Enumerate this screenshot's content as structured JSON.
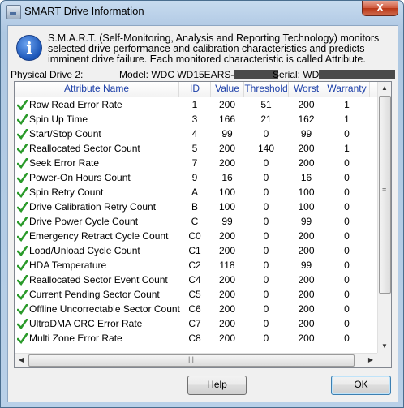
{
  "window": {
    "title": "SMART Drive Information",
    "close_label": "X"
  },
  "description": "S.M.A.R.T. (Self-Monitoring, Analysis and Reporting Technology) monitors selected drive performance and calibration characteristics and predicts imminent drive failure. Each monitored characteristic is called Attribute.",
  "drive": {
    "physical_label": "Physical Drive 2:",
    "model_label": "Model: WDC WD15EARS-",
    "serial_label": "Serial: WD"
  },
  "table": {
    "columns": [
      "Attribute Name",
      "ID",
      "Value",
      "Threshold",
      "Worst",
      "Warranty"
    ],
    "rows": [
      {
        "name": "Raw Read Error Rate",
        "id": "1",
        "value": "200",
        "threshold": "51",
        "worst": "200",
        "warranty": "1"
      },
      {
        "name": "Spin Up Time",
        "id": "3",
        "value": "166",
        "threshold": "21",
        "worst": "162",
        "warranty": "1"
      },
      {
        "name": "Start/Stop Count",
        "id": "4",
        "value": "99",
        "threshold": "0",
        "worst": "99",
        "warranty": "0"
      },
      {
        "name": "Reallocated Sector Count",
        "id": "5",
        "value": "200",
        "threshold": "140",
        "worst": "200",
        "warranty": "1"
      },
      {
        "name": "Seek Error Rate",
        "id": "7",
        "value": "200",
        "threshold": "0",
        "worst": "200",
        "warranty": "0"
      },
      {
        "name": "Power-On Hours Count",
        "id": "9",
        "value": "16",
        "threshold": "0",
        "worst": "16",
        "warranty": "0"
      },
      {
        "name": "Spin Retry Count",
        "id": "A",
        "value": "100",
        "threshold": "0",
        "worst": "100",
        "warranty": "0"
      },
      {
        "name": "Drive Calibration Retry Count",
        "id": "B",
        "value": "100",
        "threshold": "0",
        "worst": "100",
        "warranty": "0"
      },
      {
        "name": "Drive Power Cycle Count",
        "id": "C",
        "value": "99",
        "threshold": "0",
        "worst": "99",
        "warranty": "0"
      },
      {
        "name": "Emergency Retract Cycle Count",
        "id": "C0",
        "value": "200",
        "threshold": "0",
        "worst": "200",
        "warranty": "0"
      },
      {
        "name": "Load/Unload Cycle Count",
        "id": "C1",
        "value": "200",
        "threshold": "0",
        "worst": "200",
        "warranty": "0"
      },
      {
        "name": "HDA Temperature",
        "id": "C2",
        "value": "118",
        "threshold": "0",
        "worst": "99",
        "warranty": "0"
      },
      {
        "name": "Reallocated Sector Event Count",
        "id": "C4",
        "value": "200",
        "threshold": "0",
        "worst": "200",
        "warranty": "0"
      },
      {
        "name": "Current Pending Sector Count",
        "id": "C5",
        "value": "200",
        "threshold": "0",
        "worst": "200",
        "warranty": "0"
      },
      {
        "name": "Offline Uncorrectable Sector Count",
        "id": "C6",
        "value": "200",
        "threshold": "0",
        "worst": "200",
        "warranty": "0"
      },
      {
        "name": "UltraDMA CRC Error Rate",
        "id": "C7",
        "value": "200",
        "threshold": "0",
        "worst": "200",
        "warranty": "0"
      },
      {
        "name": "Multi Zone Error Rate",
        "id": "C8",
        "value": "200",
        "threshold": "0",
        "worst": "200",
        "warranty": "0"
      }
    ]
  },
  "buttons": {
    "help": "Help",
    "ok": "OK"
  },
  "icons": {
    "status": "check-icon",
    "info": "info-icon"
  },
  "colors": {
    "header_text": "#1c3fa8",
    "check": "#2a9a2a"
  }
}
